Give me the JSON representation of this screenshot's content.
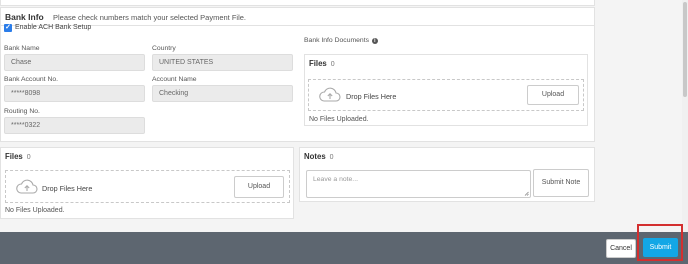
{
  "bank_info": {
    "title": "Bank Info",
    "note": "Please check numbers match your selected Payment File.",
    "ach_checkbox_label": "Enable ACH Bank Setup",
    "ach_checked": true,
    "fields": {
      "bank_name_label": "Bank Name",
      "bank_name_value": "Chase",
      "country_label": "Country",
      "country_value": "UNITED STATES",
      "account_no_label": "Bank Account No.",
      "account_no_value": "*****8098",
      "account_name_label": "Account Name",
      "account_name_value": "Checking",
      "routing_label": "Routing No.",
      "routing_value": "*****0322"
    },
    "documents": {
      "label": "Bank Info Documents",
      "files_title": "Files",
      "files_count": "0",
      "drop_text": "Drop Files Here",
      "upload_label": "Upload",
      "empty_text": "No Files Uploaded."
    }
  },
  "files": {
    "title": "Files",
    "count": "0",
    "drop_text": "Drop Files Here",
    "upload_label": "Upload",
    "empty_text": "No Files Uploaded."
  },
  "notes": {
    "title": "Notes",
    "count": "0",
    "placeholder": "Leave a note...",
    "submit_label": "Submit Note"
  },
  "footer": {
    "cancel_label": "Cancel",
    "submit_label": "Submit"
  },
  "colors": {
    "accent": "#13a7e6",
    "checkbox": "#2b7de9",
    "footer_bg": "#5d6670",
    "highlight": "#d32f2f"
  },
  "icons": {
    "info": "info-icon",
    "cloud": "cloud-upload-icon",
    "resize": "resize-handle-icon"
  }
}
